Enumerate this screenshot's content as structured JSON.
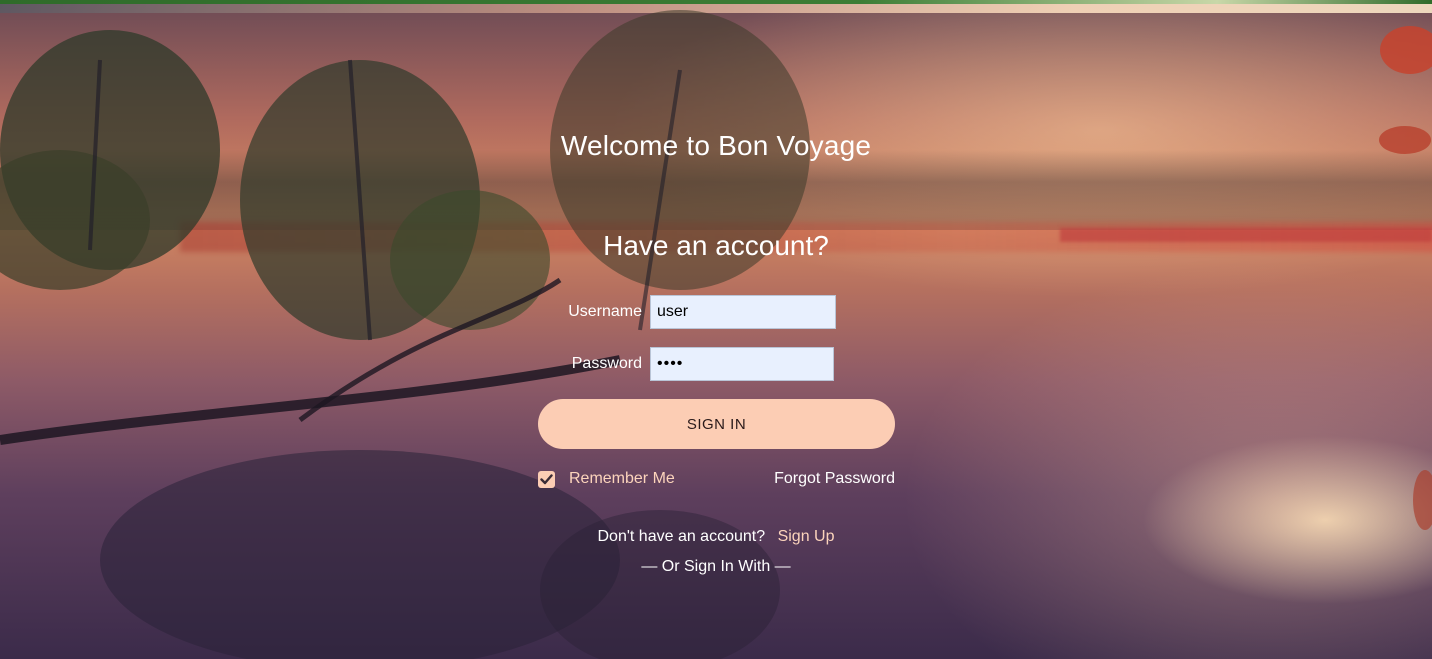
{
  "app": {
    "title": "Welcome to Bon Voyage"
  },
  "login": {
    "heading": "Have an account?",
    "username_label": "Username",
    "username_value": "user",
    "password_label": "Password",
    "password_value": "user",
    "sign_in_label": "SIGN IN",
    "remember_me_label": "Remember Me",
    "remember_me_checked": true,
    "forgot_password_label": "Forgot Password",
    "no_account_text": "Don't have an account?",
    "sign_up_label": "Sign Up",
    "or_sign_in_with": "— Or Sign In With —"
  },
  "icons": {
    "remember_checkbox": "checkmark-icon"
  },
  "colors": {
    "accent": "#fccdb4",
    "link_accent": "#fcd4bc",
    "text": "#ffffff",
    "input_bg": "#e8f0fe"
  }
}
